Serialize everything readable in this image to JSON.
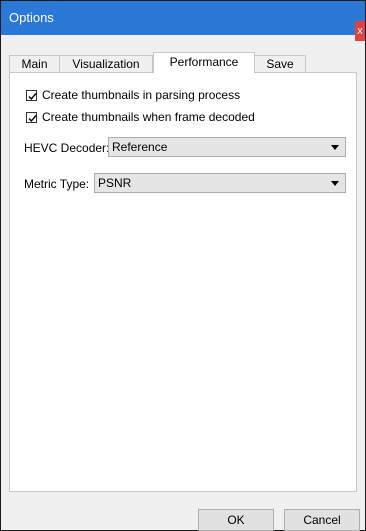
{
  "window": {
    "title": "Options",
    "close_label": "x"
  },
  "tabs": [
    {
      "label": "Main"
    },
    {
      "label": "Visualization"
    },
    {
      "label": "Performance",
      "active": true
    },
    {
      "label": "Save"
    }
  ],
  "performance": {
    "create_thumbnails_parsing": {
      "label": "Create thumbnails in parsing process",
      "checked": true
    },
    "create_thumbnails_decoded": {
      "label": "Create thumbnails when frame decoded",
      "checked": true
    },
    "hevc_decoder": {
      "label": "HEVC Decoder:",
      "value": "Reference"
    },
    "metric_type": {
      "label": "Metric Type:",
      "value": "PSNR"
    }
  },
  "buttons": {
    "ok": "OK",
    "cancel": "Cancel"
  }
}
